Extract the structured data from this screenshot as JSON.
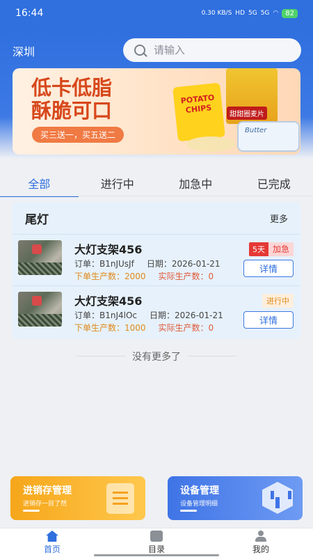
{
  "status_bar": {
    "time": "16:44",
    "speed": "0.30 KB/S",
    "hd": "HD",
    "net1": "5G",
    "net2": "5G",
    "battery": "82"
  },
  "header": {
    "city": "深圳",
    "search_placeholder": "请输入"
  },
  "banner": {
    "title_line1": "低卡低脂",
    "title_line2": "酥脆可口",
    "promo": "买三送一，买五送二",
    "chips_text": "POTATO CHIPS",
    "cereal_label": "甜甜圈麦片",
    "tub_label": "Butter"
  },
  "tabs": [
    {
      "label": "全部"
    },
    {
      "label": "进行中"
    },
    {
      "label": "加急中"
    },
    {
      "label": "已完成"
    }
  ],
  "panel": {
    "title": "尾灯",
    "more": "更多",
    "orders": [
      {
        "name": "大灯支架456",
        "order_label": "订单：B1nJUsJf",
        "date_label": "日期：2026-01-21",
        "plan_label": "下单生产数：2000",
        "actual_label": "实际生产数：0",
        "tag_days": "5天",
        "tag_status": "加急",
        "button": "详情"
      },
      {
        "name": "大灯支架456",
        "order_label": "订单：B1nJ4lOc",
        "date_label": "日期：2026-01-21",
        "plan_label": "下单生产数：1000",
        "actual_label": "实际生产数：0",
        "tag_status": "进行中",
        "button": "详情"
      }
    ]
  },
  "no_more": "没有更多了",
  "cards": [
    {
      "title": "进销存管理",
      "subtitle": "进销存一目了然",
      "icon": "document-list-icon"
    },
    {
      "title": "设备管理",
      "subtitle": "设备管理明细",
      "icon": "cube-icon"
    }
  ],
  "bottom_nav": [
    {
      "label": "首页"
    },
    {
      "label": "目录"
    },
    {
      "label": "我的"
    }
  ],
  "colors": {
    "primary": "#2f6fde",
    "urgent": "#e53935",
    "warning": "#e0891b",
    "card_orange": "#f6a61a",
    "card_blue": "#3f74e6"
  }
}
